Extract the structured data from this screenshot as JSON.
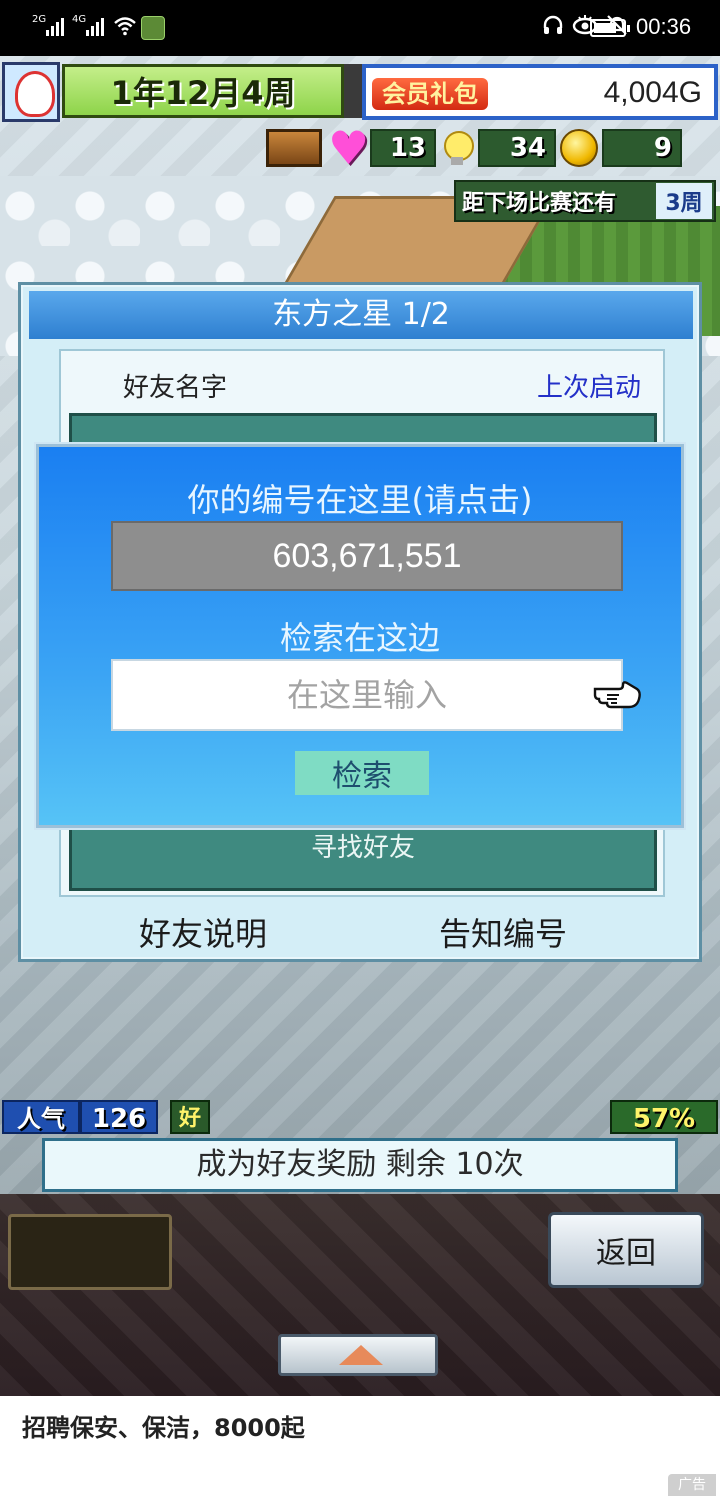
{
  "status_bar": {
    "signal_1": "2G",
    "signal_2": "4G",
    "time": "00:36"
  },
  "hud": {
    "date": "1年12月4周",
    "vip_label": "会员礼包",
    "money": "4,004G",
    "stat_1": "13",
    "stat_2": "34",
    "stat_3": "9",
    "next_match_text": "距下场比赛还有",
    "next_match_weeks": "3周",
    "popularity_label": "人气",
    "popularity_value": "126",
    "good_label": "好",
    "percent": "57%"
  },
  "friend_dialog": {
    "title": "东方之星 1/2",
    "col_name": "好友名字",
    "col_last_login": "上次启动",
    "find_friend": "寻找好友",
    "friend_help_button": "好友说明",
    "notify_id_button": "告知编号"
  },
  "search_dialog": {
    "id_prompt": "你的编号在这里(请点击)",
    "id_value": "603,671,551",
    "search_prompt": "检索在这边",
    "search_placeholder": "在这里输入",
    "search_value": "",
    "search_button": "检索"
  },
  "bottom": {
    "reward_banner": "成为好友奖励 剩余 10次",
    "back_button": "返回"
  },
  "ad": {
    "text": "招聘保安、保洁，8000起",
    "mark": "广告"
  },
  "colors": {
    "dialog_blue": "#2e7fd0",
    "search_panel": "#1a7ff2",
    "id_box": "#8e8e8e",
    "search_button": "#7fdcc4",
    "last_login_blue": "#2330c8"
  }
}
